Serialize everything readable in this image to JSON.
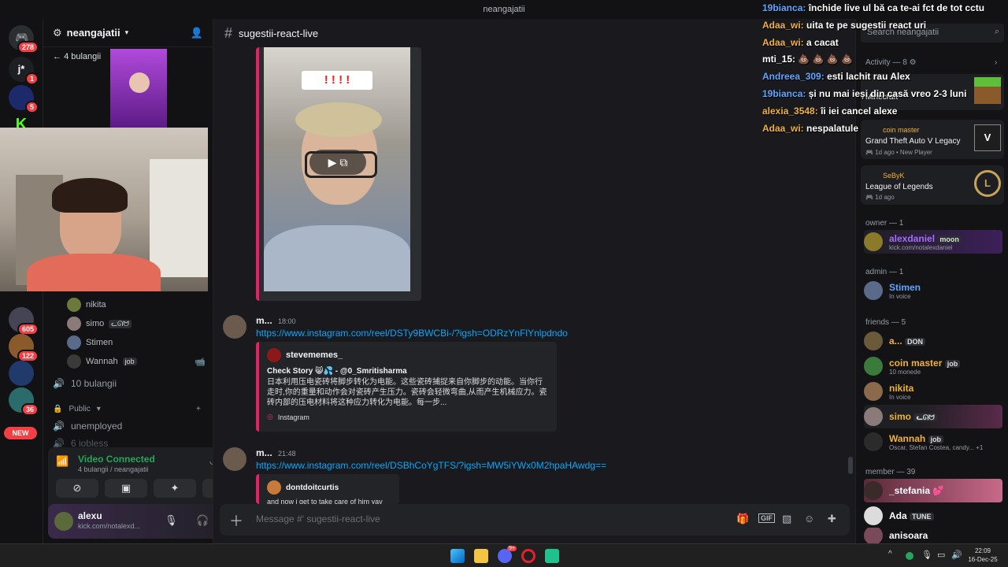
{
  "window": {
    "title": "neangajatii"
  },
  "rail": {
    "badges": [
      "278",
      "1",
      "5",
      "605",
      "122",
      "36"
    ],
    "new_label": "NEW"
  },
  "sidebar": {
    "guild_name": "neangajatii",
    "stage_back": "4 bulangii",
    "voice_users": [
      {
        "name": "nikita",
        "tag": ""
      },
      {
        "name": "simo",
        "tag": "ᓚᘏᗢ"
      },
      {
        "name": "Stimen",
        "tag": ""
      },
      {
        "name": "Wannah",
        "tag": "job"
      }
    ],
    "channels": [
      {
        "name": "10 bulangii"
      },
      {
        "name": "Public"
      },
      {
        "name": "unemployed"
      },
      {
        "name": "6 iobless"
      }
    ],
    "voice_panel": {
      "status": "Video Connected",
      "detail": "4 bulangii / neangajatii"
    },
    "user": {
      "name": "alexu",
      "status": "kick.com/notalexd..."
    }
  },
  "main": {
    "channel_name": "sugestii-react-live",
    "video_sticker": "! ! ! !",
    "messages": [
      {
        "author": "m...",
        "time": "18:00",
        "link": "https://www.instagram.com/reel/DSTy9BWCBi-/?igsh=ODRzYnFlYnlpdndo",
        "embed_author": "stevememes_",
        "embed_title": "Check Story 😸💦 - @0_Smritisharma",
        "embed_body": "日本利用压电瓷砖将脚步转化为电能。这些瓷砖捕捉来自你脚步的动能。当你行走时,你的重量和动作会对瓷砖产生压力。瓷砖会轻微弯曲,从而产生机械应力。瓷砖内部的压电材料将这种应力转化为电能。每一步...",
        "embed_source": "Instagram"
      },
      {
        "author": "m...",
        "time": "21:48",
        "link": "https://www.instagram.com/reel/DSBhCoYgTFS/?igsh=MW5iYWx0M2hpaHAwdg==",
        "embed_author": "dontdoitcurtis",
        "embed_body": "and now i get to take care of him yay"
      }
    ],
    "composer_placeholder": "Message #' sugestii-react-live"
  },
  "right": {
    "search_placeholder": "Search neangajatii",
    "activity_label": "Activity — 8",
    "activities": [
      {
        "user": "Minecraft",
        "game": ""
      },
      {
        "user": "coin master",
        "game": "Grand Theft Auto V Legacy",
        "meta": "1d ago",
        "meta2": "New Player"
      },
      {
        "user": "SeByK",
        "game": "League of Legends",
        "meta": "1d ago"
      }
    ],
    "sections": {
      "owner": "owner — 1",
      "admin": "admin — 1",
      "friends": "friends — 5",
      "member": "member — 39"
    },
    "owner": [
      {
        "name": "alexdaniel",
        "tag": "moon",
        "sub": "kick.com/notalexdaniel",
        "color": "#a66bff"
      }
    ],
    "admin": [
      {
        "name": "Stimen",
        "sub": "In voice",
        "color": "#5ba7ff"
      }
    ],
    "friends": [
      {
        "name": "a...",
        "tag": "DON",
        "sub": "",
        "color": "#f0b232"
      },
      {
        "name": "coin master",
        "tag": "job",
        "sub": "10 monede",
        "color": "#f0b232"
      },
      {
        "name": "nikita",
        "tag": "",
        "sub": "In voice",
        "color": "#f0b232"
      },
      {
        "name": "simo",
        "tag": "ᓚᘏᗢ",
        "sub": "",
        "color": "#f0b232"
      },
      {
        "name": "Wannah",
        "tag": "job",
        "sub": "Oscar, Stefan Costea, candy...",
        "extra": "+1",
        "color": "#f0b232"
      }
    ],
    "members": [
      {
        "name": "_stefania",
        "tag": "💕",
        "color": "#ffffff"
      },
      {
        "name": "Ada",
        "tag": "TUNE",
        "color": "#ffffff"
      },
      {
        "name": "anisoara",
        "tag": "",
        "color": "#ffffff"
      }
    ]
  },
  "stream_chat": [
    {
      "user": "19bianca:",
      "text": "închide live ul bă ca te-ai fct de tot cctu",
      "color": "#5ba7ff"
    },
    {
      "user": "Adaa_wi:",
      "text": "uita te pe sugestii react uri",
      "color": "#f0b232"
    },
    {
      "user": "Adaa_wi:",
      "text": "a cacat",
      "color": "#f0b232"
    },
    {
      "user": "mti_15:",
      "text": "💩 💩 💩 💩",
      "color": "#ffffff"
    },
    {
      "user": "Andreea_309:",
      "text": "esti lachit rau Alex",
      "color": "#5ba7ff"
    },
    {
      "user": "19bianca:",
      "text": "și nu mai ieși din casă vreo 2-3 luni",
      "color": "#5ba7ff"
    },
    {
      "user": "alexia_3548:",
      "text": "îi iei cancel alexe",
      "color": "#f0b232"
    },
    {
      "user": "Adaa_wi:",
      "text": "nespalatule",
      "color": "#f0b232"
    }
  ],
  "taskbar": {
    "time": "22:09",
    "date": "16-Dec-25",
    "discord_badge": "9+"
  },
  "colors": {
    "accent": "#5865f2",
    "mention": "#e91e63",
    "link": "#00a8fc",
    "online": "#23a55a"
  }
}
